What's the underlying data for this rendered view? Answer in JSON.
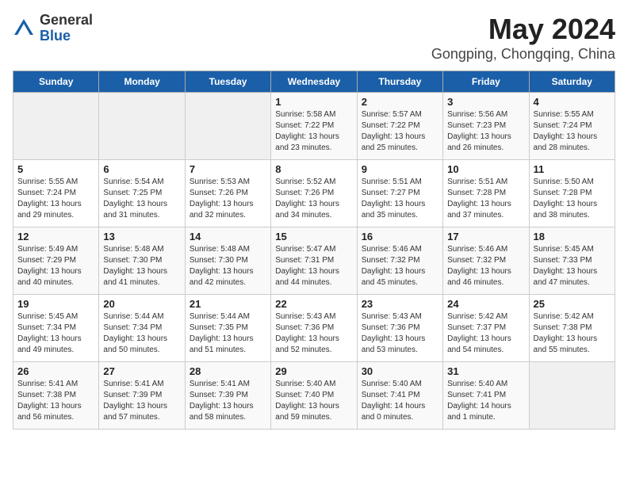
{
  "header": {
    "logo_general": "General",
    "logo_blue": "Blue",
    "month": "May 2024",
    "location": "Gongping, Chongqing, China"
  },
  "days_of_week": [
    "Sunday",
    "Monday",
    "Tuesday",
    "Wednesday",
    "Thursday",
    "Friday",
    "Saturday"
  ],
  "weeks": [
    [
      {
        "day": "",
        "info": ""
      },
      {
        "day": "",
        "info": ""
      },
      {
        "day": "",
        "info": ""
      },
      {
        "day": "1",
        "info": "Sunrise: 5:58 AM\nSunset: 7:22 PM\nDaylight: 13 hours\nand 23 minutes."
      },
      {
        "day": "2",
        "info": "Sunrise: 5:57 AM\nSunset: 7:22 PM\nDaylight: 13 hours\nand 25 minutes."
      },
      {
        "day": "3",
        "info": "Sunrise: 5:56 AM\nSunset: 7:23 PM\nDaylight: 13 hours\nand 26 minutes."
      },
      {
        "day": "4",
        "info": "Sunrise: 5:55 AM\nSunset: 7:24 PM\nDaylight: 13 hours\nand 28 minutes."
      }
    ],
    [
      {
        "day": "5",
        "info": "Sunrise: 5:55 AM\nSunset: 7:24 PM\nDaylight: 13 hours\nand 29 minutes."
      },
      {
        "day": "6",
        "info": "Sunrise: 5:54 AM\nSunset: 7:25 PM\nDaylight: 13 hours\nand 31 minutes."
      },
      {
        "day": "7",
        "info": "Sunrise: 5:53 AM\nSunset: 7:26 PM\nDaylight: 13 hours\nand 32 minutes."
      },
      {
        "day": "8",
        "info": "Sunrise: 5:52 AM\nSunset: 7:26 PM\nDaylight: 13 hours\nand 34 minutes."
      },
      {
        "day": "9",
        "info": "Sunrise: 5:51 AM\nSunset: 7:27 PM\nDaylight: 13 hours\nand 35 minutes."
      },
      {
        "day": "10",
        "info": "Sunrise: 5:51 AM\nSunset: 7:28 PM\nDaylight: 13 hours\nand 37 minutes."
      },
      {
        "day": "11",
        "info": "Sunrise: 5:50 AM\nSunset: 7:28 PM\nDaylight: 13 hours\nand 38 minutes."
      }
    ],
    [
      {
        "day": "12",
        "info": "Sunrise: 5:49 AM\nSunset: 7:29 PM\nDaylight: 13 hours\nand 40 minutes."
      },
      {
        "day": "13",
        "info": "Sunrise: 5:48 AM\nSunset: 7:30 PM\nDaylight: 13 hours\nand 41 minutes."
      },
      {
        "day": "14",
        "info": "Sunrise: 5:48 AM\nSunset: 7:30 PM\nDaylight: 13 hours\nand 42 minutes."
      },
      {
        "day": "15",
        "info": "Sunrise: 5:47 AM\nSunset: 7:31 PM\nDaylight: 13 hours\nand 44 minutes."
      },
      {
        "day": "16",
        "info": "Sunrise: 5:46 AM\nSunset: 7:32 PM\nDaylight: 13 hours\nand 45 minutes."
      },
      {
        "day": "17",
        "info": "Sunrise: 5:46 AM\nSunset: 7:32 PM\nDaylight: 13 hours\nand 46 minutes."
      },
      {
        "day": "18",
        "info": "Sunrise: 5:45 AM\nSunset: 7:33 PM\nDaylight: 13 hours\nand 47 minutes."
      }
    ],
    [
      {
        "day": "19",
        "info": "Sunrise: 5:45 AM\nSunset: 7:34 PM\nDaylight: 13 hours\nand 49 minutes."
      },
      {
        "day": "20",
        "info": "Sunrise: 5:44 AM\nSunset: 7:34 PM\nDaylight: 13 hours\nand 50 minutes."
      },
      {
        "day": "21",
        "info": "Sunrise: 5:44 AM\nSunset: 7:35 PM\nDaylight: 13 hours\nand 51 minutes."
      },
      {
        "day": "22",
        "info": "Sunrise: 5:43 AM\nSunset: 7:36 PM\nDaylight: 13 hours\nand 52 minutes."
      },
      {
        "day": "23",
        "info": "Sunrise: 5:43 AM\nSunset: 7:36 PM\nDaylight: 13 hours\nand 53 minutes."
      },
      {
        "day": "24",
        "info": "Sunrise: 5:42 AM\nSunset: 7:37 PM\nDaylight: 13 hours\nand 54 minutes."
      },
      {
        "day": "25",
        "info": "Sunrise: 5:42 AM\nSunset: 7:38 PM\nDaylight: 13 hours\nand 55 minutes."
      }
    ],
    [
      {
        "day": "26",
        "info": "Sunrise: 5:41 AM\nSunset: 7:38 PM\nDaylight: 13 hours\nand 56 minutes."
      },
      {
        "day": "27",
        "info": "Sunrise: 5:41 AM\nSunset: 7:39 PM\nDaylight: 13 hours\nand 57 minutes."
      },
      {
        "day": "28",
        "info": "Sunrise: 5:41 AM\nSunset: 7:39 PM\nDaylight: 13 hours\nand 58 minutes."
      },
      {
        "day": "29",
        "info": "Sunrise: 5:40 AM\nSunset: 7:40 PM\nDaylight: 13 hours\nand 59 minutes."
      },
      {
        "day": "30",
        "info": "Sunrise: 5:40 AM\nSunset: 7:41 PM\nDaylight: 14 hours\nand 0 minutes."
      },
      {
        "day": "31",
        "info": "Sunrise: 5:40 AM\nSunset: 7:41 PM\nDaylight: 14 hours\nand 1 minute."
      },
      {
        "day": "",
        "info": ""
      }
    ]
  ]
}
